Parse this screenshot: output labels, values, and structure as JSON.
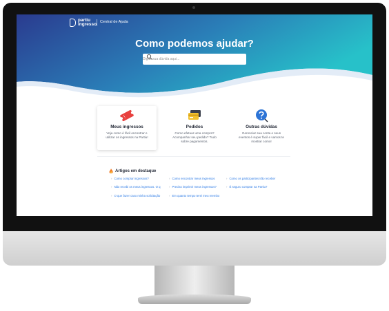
{
  "header": {
    "logo_line1": "partiu",
    "logo_line2": "ingresso",
    "help_link": "Central de Ajuda"
  },
  "hero": {
    "title": "Como podemos ajudar?",
    "search_placeholder": "Digite sua dúvida aqui...",
    "gradient_start": "#2a3b8f",
    "gradient_end": "#27c1c9"
  },
  "categories": [
    {
      "title": "Meus ingressos",
      "description": "Veja como é fácil encontrar e utilizar os ingressos na Partiu!",
      "icon": "ticket-icon",
      "color": "#e8413f"
    },
    {
      "title": "Pedidos",
      "description": "Como efetuar uma compra? Acompanhar seu pedido? Tudo sobre pagamentos.",
      "icon": "credit-card-icon",
      "color": "#f2c230"
    },
    {
      "title": "Outras dúvidas",
      "description": "Gerenciar sua conta e seus eventos é super fácil e vamos te mostrar como!",
      "icon": "question-icon",
      "color": "#2d74d6"
    }
  ],
  "featured": {
    "title": "Artigos em destaque",
    "articles": [
      "Como comprar ingressos?",
      "Como encontrar meus ingressos",
      "Como os participantes irão receber",
      "Não recebi os meus ingressos. O q",
      "Preciso imprimir meus ingressos?",
      "É seguro comprar na Partiu?",
      "O que fazer caso minha solicitação",
      "Em quanto tempo terei meu reembo"
    ]
  }
}
